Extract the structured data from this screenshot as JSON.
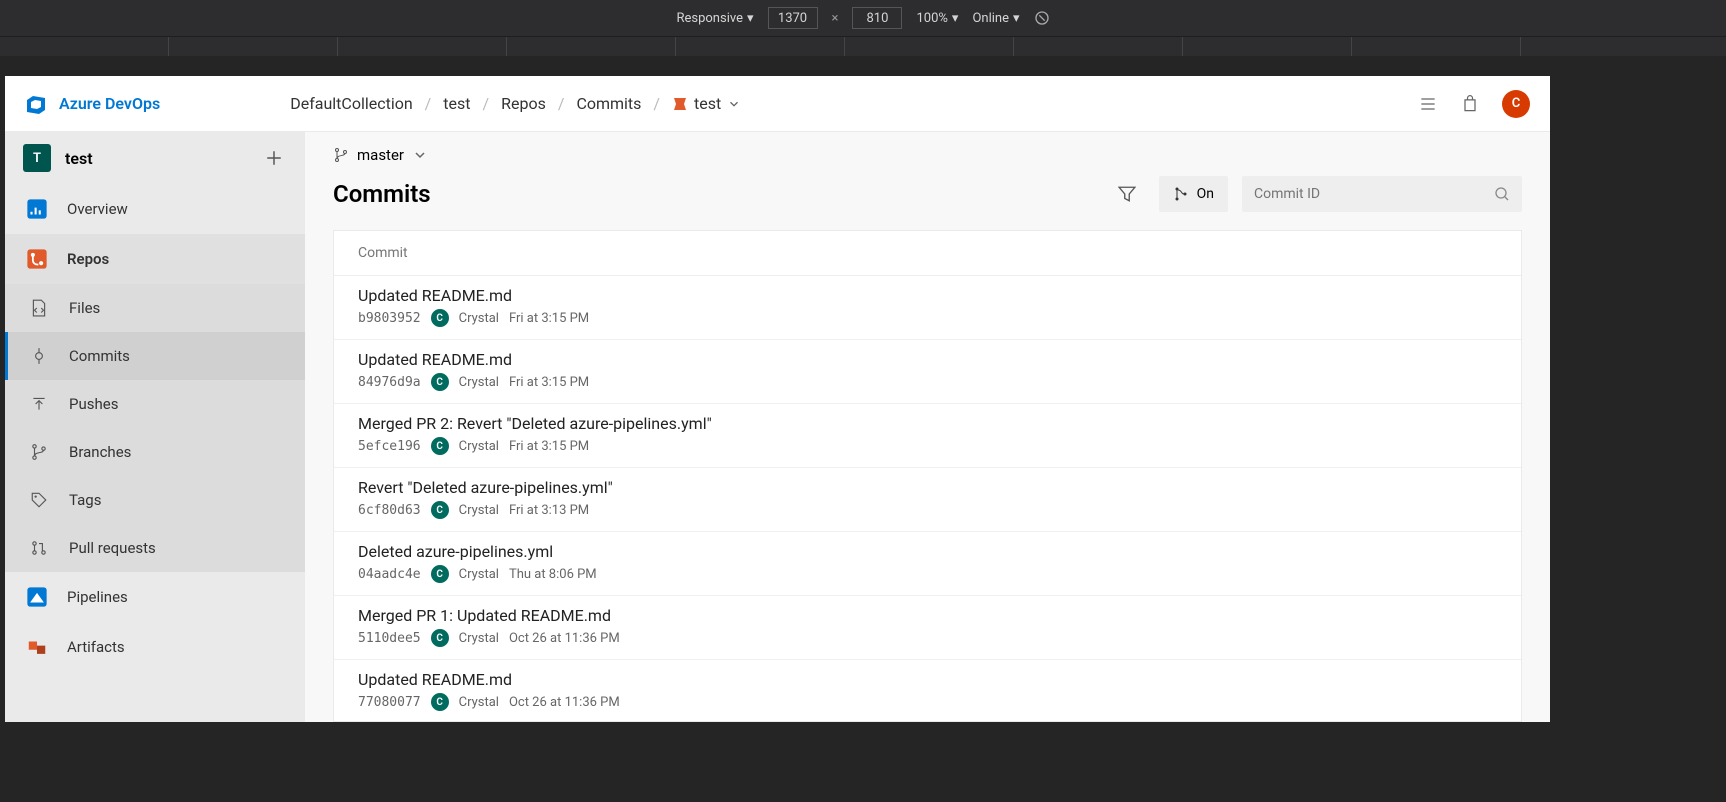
{
  "devtools": {
    "device": "Responsive",
    "width": "1370",
    "height": "810",
    "zoom": "100%",
    "network": "Online"
  },
  "header": {
    "product": "Azure DevOps",
    "avatar_letter": "C"
  },
  "breadcrumbs": {
    "collection": "DefaultCollection",
    "project": "test",
    "area": "Repos",
    "page": "Commits",
    "repo": "test"
  },
  "sidebar": {
    "project_badge": "T",
    "project_name": "test",
    "overview": "Overview",
    "repos": "Repos",
    "files": "Files",
    "commits": "Commits",
    "pushes": "Pushes",
    "branches": "Branches",
    "tags": "Tags",
    "pull_requests": "Pull requests",
    "pipelines": "Pipelines",
    "artifacts": "Artifacts"
  },
  "main": {
    "branch": "master",
    "title": "Commits",
    "graph_toggle": "On",
    "search_placeholder": "Commit ID",
    "column_header": "Commit"
  },
  "commits": [
    {
      "title": "Updated README.md",
      "hash": "b9803952",
      "author": "Crystal",
      "time": "Fri at 3:15 PM",
      "badge": "C"
    },
    {
      "title": "Updated README.md",
      "hash": "84976d9a",
      "author": "Crystal",
      "time": "Fri at 3:15 PM",
      "badge": "C"
    },
    {
      "title": "Merged PR 2: Revert \"Deleted azure-pipelines.yml\"",
      "hash": "5efce196",
      "author": "Crystal",
      "time": "Fri at 3:15 PM",
      "badge": "C"
    },
    {
      "title": "Revert \"Deleted azure-pipelines.yml\"",
      "hash": "6cf80d63",
      "author": "Crystal",
      "time": "Fri at 3:13 PM",
      "badge": "C"
    },
    {
      "title": "Deleted azure-pipelines.yml",
      "hash": "04aadc4e",
      "author": "Crystal",
      "time": "Thu at 8:06 PM",
      "badge": "C"
    },
    {
      "title": "Merged PR 1: Updated README.md",
      "hash": "5110dee5",
      "author": "Crystal",
      "time": "Oct 26 at 11:36 PM",
      "badge": "C"
    },
    {
      "title": "Updated README.md",
      "hash": "77080077",
      "author": "Crystal",
      "time": "Oct 26 at 11:36 PM",
      "badge": "C"
    }
  ]
}
